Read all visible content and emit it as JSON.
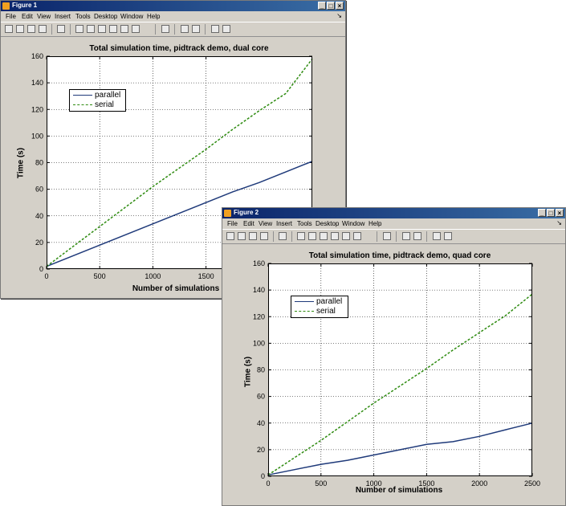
{
  "fig1": {
    "title": "Figure 1",
    "menu": [
      "File",
      "Edit",
      "View",
      "Insert",
      "Tools",
      "Desktop",
      "Window",
      "Help"
    ],
    "menu_arrow": "↘",
    "window_buttons": [
      "_",
      "□",
      "×"
    ]
  },
  "fig2": {
    "title": "Figure 2",
    "menu": [
      "File",
      "Edit",
      "View",
      "Insert",
      "Tools",
      "Desktop",
      "Window",
      "Help"
    ],
    "menu_arrow": "↘",
    "window_buttons": [
      "_",
      "□",
      "×"
    ]
  },
  "chart_data": [
    {
      "type": "line",
      "title": "Total simulation time, pidtrack demo, dual core",
      "xlabel": "Number of simulations",
      "ylabel": "Time (s)",
      "xlim": [
        0,
        2500
      ],
      "ylim": [
        0,
        160
      ],
      "xticks": [
        "0",
        "500",
        "1000",
        "1500"
      ],
      "yticks": [
        "0",
        "20",
        "40",
        "60",
        "80",
        "100",
        "120",
        "140",
        "160"
      ],
      "grid": true,
      "legend_position": "top-left",
      "series": [
        {
          "name": "parallel",
          "color": "#1f3a7a",
          "dash": "",
          "x": [
            0,
            250,
            500,
            750,
            1000,
            1250,
            1500,
            1750,
            2000,
            2250,
            2500
          ],
          "y": [
            2,
            10,
            18,
            26,
            34,
            42,
            50,
            58,
            65,
            73,
            81
          ]
        },
        {
          "name": "serial",
          "color": "#2e8b10",
          "dash": "3,2",
          "x": [
            0,
            250,
            500,
            750,
            1000,
            1250,
            1500,
            1750,
            2000,
            2250,
            2500
          ],
          "y": [
            2,
            17,
            32,
            47,
            62,
            76,
            90,
            105,
            119,
            132,
            158
          ]
        }
      ]
    },
    {
      "type": "line",
      "title": "Total simulation time, pidtrack demo, quad core",
      "xlabel": "Number of simulations",
      "ylabel": "Time (s)",
      "xlim": [
        0,
        2500
      ],
      "ylim": [
        0,
        160
      ],
      "xticks": [
        "0",
        "500",
        "1000",
        "1500",
        "2000",
        "2500"
      ],
      "yticks": [
        "0",
        "20",
        "40",
        "60",
        "80",
        "100",
        "120",
        "140",
        "160"
      ],
      "grid": true,
      "legend_position": "top-left",
      "series": [
        {
          "name": "parallel",
          "color": "#1f3a7a",
          "dash": "",
          "x": [
            0,
            250,
            500,
            750,
            1000,
            1250,
            1500,
            1750,
            2000,
            2250,
            2500
          ],
          "y": [
            1,
            5,
            9,
            12,
            16,
            20,
            24,
            26,
            30,
            35,
            40
          ]
        },
        {
          "name": "serial",
          "color": "#2e8b10",
          "dash": "3,2",
          "x": [
            0,
            250,
            500,
            750,
            1000,
            1250,
            1500,
            1750,
            2000,
            2250,
            2500
          ],
          "y": [
            1,
            14,
            27,
            41,
            55,
            68,
            81,
            95,
            108,
            121,
            137
          ]
        }
      ]
    }
  ]
}
